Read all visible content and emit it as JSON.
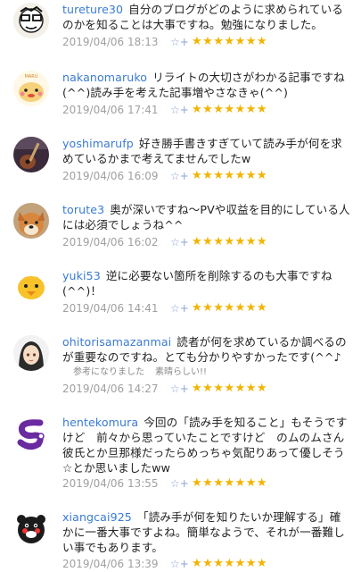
{
  "comments": [
    {
      "user": "tureture30",
      "text": "自分のブログがどのように求められているのかを知ることは大事ですね。勉強になりました。",
      "date": "2019/04/06 18:13",
      "stars": "★★★★★★★"
    },
    {
      "user": "nakanomaruko",
      "text": "リライトの大切さがわかる記事ですね(^^)読み手を考えた記事増やさなきゃ(^^)",
      "date": "2019/04/06 17:41",
      "stars": "★★★★★★★"
    },
    {
      "user": "yoshimarufp",
      "text": "好き勝手書きすぎていて読み手が何を求めているかまで考えてませんでしたw",
      "date": "2019/04/06 16:09",
      "stars": "★★★★★★★"
    },
    {
      "user": "torute3",
      "text": "奥が深いですね〜PVや収益を目的にしている人には必須でしょうね^^",
      "date": "2019/04/06 16:02",
      "stars": "★★★★★★★"
    },
    {
      "user": "yuki53",
      "text": "逆に必要ない箇所を削除するのも大事ですね(^^)！",
      "date": "2019/04/06 14:41",
      "stars": "★★★★★★★"
    },
    {
      "user": "ohitorisamazanmai",
      "text": "読者が何を求めているか調べるのが重要なのですね。とても分かりやすかったです(^^♪",
      "reactions": [
        "参考になりました",
        "素晴らしい!!"
      ],
      "date": "2019/04/06 14:27",
      "stars": "★★★★★★★"
    },
    {
      "user": "hentekomura",
      "text": "今回の「読み手を知ること」もそうですけど　前々から思っていたことですけど　のムのムさん彼氏とか旦那様だったらめっちゃ気配りあって優しそう☆とか思いましたww",
      "date": "2019/04/06 13:55",
      "stars": "★★★★★★★"
    },
    {
      "user": "xiangcai925",
      "text": "「読み手が何を知りたいか理解する」確かに一番大事ですよね。簡単なようで、それが一番難しい事でもあります。",
      "date": "2019/04/06 13:39",
      "stars": "★★★★★★★"
    }
  ],
  "icons": {
    "add_star": "☆+",
    "avatars": [
      "face-glasses-icon",
      "character-icon",
      "guitar-photo-icon",
      "dog-photo-icon",
      "bird-mascot-icon",
      "anime-girl-icon",
      "purple-s-logo-icon",
      "kumamon-icon"
    ]
  }
}
